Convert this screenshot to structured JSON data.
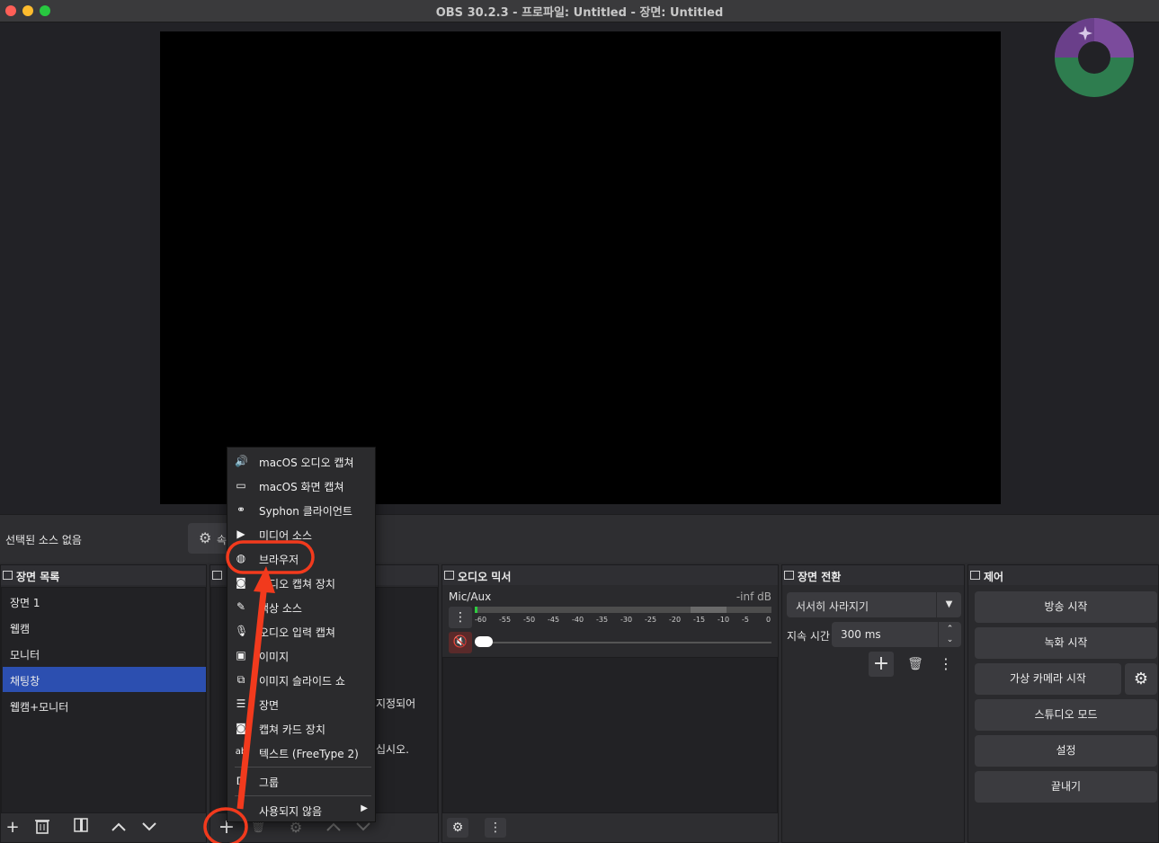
{
  "window": {
    "title": "OBS 30.2.3 - 프로파일: Untitled - 장면: Untitled",
    "lights": [
      "#ff5f57",
      "#febc2e",
      "#28c840"
    ]
  },
  "context_bar": {
    "no_source_label": "선택된 소스 없음",
    "properties_label": "속"
  },
  "scenes": {
    "title": "장면 목록",
    "items": [
      "장면 1",
      "웹캠",
      "모니터",
      "채팅창",
      "웹캠+모니터"
    ],
    "selected_index": 3
  },
  "sources": {
    "partial_text_1": "지정되어",
    "partial_text_2": "십시오."
  },
  "audio_mixer": {
    "title": "오디오 믹서",
    "channel": "Mic/Aux",
    "level": "-inf dB",
    "ticks": [
      "-60",
      "-55",
      "-50",
      "-45",
      "-40",
      "-35",
      "-30",
      "-25",
      "-20",
      "-15",
      "-10",
      "-5",
      "0"
    ]
  },
  "transitions": {
    "title": "장면 전환",
    "selected": "서서히 사라지기",
    "duration_label": "지속 시간",
    "duration_value": "300 ms"
  },
  "controls": {
    "title": "제어",
    "buttons": [
      "방송 시작",
      "녹화 시작",
      "가상 카메라 시작",
      "스튜디오 모드",
      "설정",
      "끝내기"
    ]
  },
  "add_source_menu": {
    "items": [
      {
        "icon": "speaker-icon",
        "label": "macOS 오디오 캡쳐"
      },
      {
        "icon": "monitor-icon",
        "label": "macOS 화면 캡쳐"
      },
      {
        "icon": "syphon-icon",
        "label": "Syphon 클라이언트"
      },
      {
        "icon": "play-icon",
        "label": "미디어 소스"
      },
      {
        "icon": "globe-icon",
        "label": "브라우저"
      },
      {
        "icon": "camera-icon",
        "label": "비디오 캡쳐 장치"
      },
      {
        "icon": "brush-icon",
        "label": "색상 소스"
      },
      {
        "icon": "microphone-icon",
        "label": "오디오 입력 캡쳐"
      },
      {
        "icon": "image-icon",
        "label": "이미지"
      },
      {
        "icon": "slideshow-icon",
        "label": "이미지 슬라이드 쇼"
      },
      {
        "icon": "list-icon",
        "label": "장면"
      },
      {
        "icon": "camera-icon",
        "label": "캡쳐 카드 장치"
      },
      {
        "icon": "text-icon",
        "label": "텍스트 (FreeType 2)"
      },
      {
        "icon": "group-icon",
        "label": "그룹"
      },
      {
        "icon": "chevron-right-icon",
        "label": "사용되지 않음"
      }
    ]
  },
  "annotation": {
    "color": "#f23a1d"
  }
}
